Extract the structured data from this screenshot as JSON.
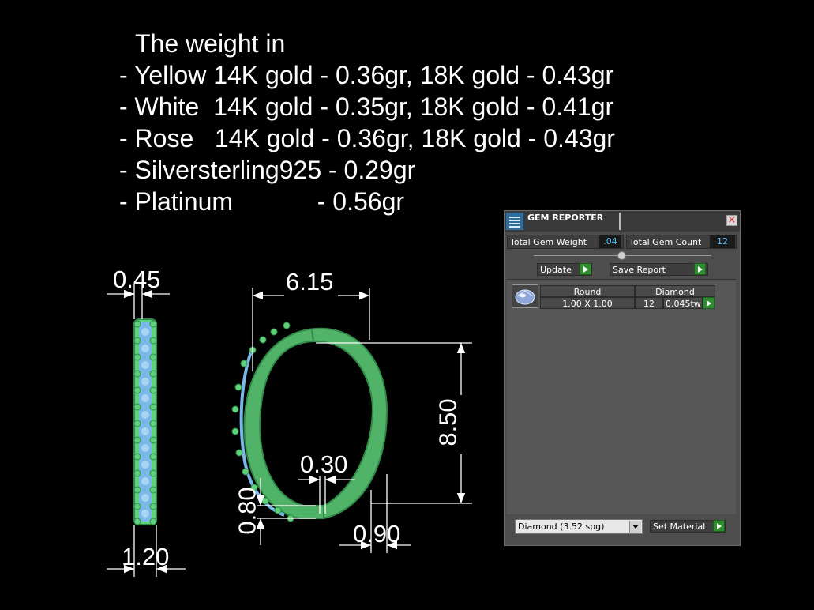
{
  "weights": {
    "heading": "The weight in",
    "lines": [
      "- Yellow 14K gold - 0.36gr, 18K gold - 0.43gr",
      "- White  14K gold - 0.35gr, 18K gold - 0.41gr",
      "- Rose   14K gold - 0.36gr, 18K gold - 0.43gr",
      "- Silversterling925 - 0.29gr",
      "- Platinum            - 0.56gr"
    ]
  },
  "dimensions": {
    "side_top_width": "0.45",
    "side_bottom_width": "1.20",
    "top_width": "6.15",
    "height": "8.50",
    "gap": "0.30",
    "gap_height": "0.80",
    "shank_width": "0.90"
  },
  "gem_reporter": {
    "title": "GEM REPORTER",
    "close_icon": "close-icon",
    "total_gem_weight_label": "Total Gem Weight",
    "total_gem_weight_value": ".04",
    "total_gem_count_label": "Total Gem Count",
    "total_gem_count_value": "12",
    "update_label": "Update",
    "save_report_label": "Save Report",
    "row": {
      "shape": "Round",
      "size": "1.00 X 1.00",
      "material": "Diamond",
      "count": "12",
      "weight": "0.045tw"
    },
    "material_select": "Diamond    (3.52 spg)",
    "set_material_label": "Set Material"
  },
  "colors": {
    "metal": "#5ed27a",
    "gem": "#7ab8e8",
    "accent_value": "#4ec0ff",
    "button_green": "#2e8f2e"
  }
}
